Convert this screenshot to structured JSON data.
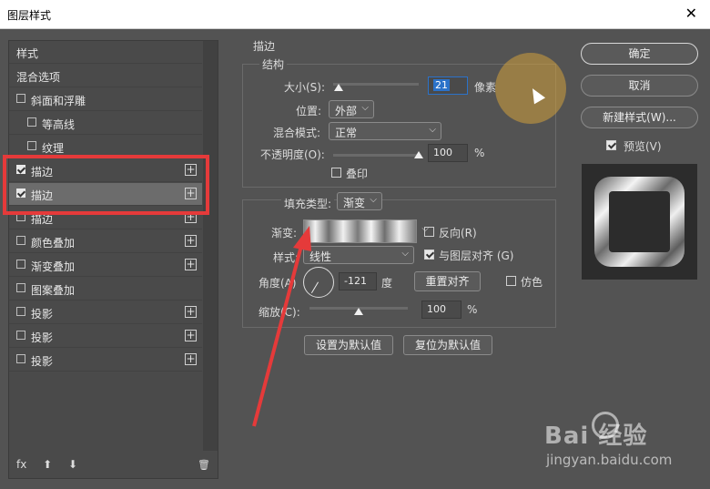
{
  "window": {
    "title": "图层样式",
    "close": "✕"
  },
  "left": {
    "items": [
      {
        "label": "样式",
        "checkbox": false,
        "plus": false,
        "indent": 0,
        "checked": false
      },
      {
        "label": "混合选项",
        "checkbox": false,
        "plus": false,
        "indent": 0,
        "checked": false
      },
      {
        "label": "斜面和浮雕",
        "checkbox": true,
        "plus": false,
        "indent": 0,
        "checked": false
      },
      {
        "label": "等高线",
        "checkbox": true,
        "plus": false,
        "indent": 1,
        "checked": false
      },
      {
        "label": "纹理",
        "checkbox": true,
        "plus": false,
        "indent": 1,
        "checked": false
      },
      {
        "label": "描边",
        "checkbox": true,
        "plus": true,
        "indent": 0,
        "checked": true
      },
      {
        "label": "描边",
        "checkbox": true,
        "plus": true,
        "indent": 0,
        "checked": true,
        "selected": true
      },
      {
        "label": "描边",
        "checkbox": true,
        "plus": true,
        "indent": 0,
        "checked": false
      },
      {
        "label": "颜色叠加",
        "checkbox": true,
        "plus": true,
        "indent": 0,
        "checked": false
      },
      {
        "label": "渐变叠加",
        "checkbox": true,
        "plus": true,
        "indent": 0,
        "checked": false
      },
      {
        "label": "图案叠加",
        "checkbox": true,
        "plus": false,
        "indent": 0,
        "checked": false
      },
      {
        "label": "投影",
        "checkbox": true,
        "plus": true,
        "indent": 0,
        "checked": false
      },
      {
        "label": "投影",
        "checkbox": true,
        "plus": true,
        "indent": 0,
        "checked": false
      },
      {
        "label": "投影",
        "checkbox": true,
        "plus": true,
        "indent": 0,
        "checked": false
      }
    ],
    "bottom": {
      "fx": "fx",
      "up": "⬆",
      "down": "⬇",
      "trash": "🗑"
    }
  },
  "stroke": {
    "group_title": "描边",
    "structure_title": "结构",
    "size_label": "大小(S):",
    "size_value": "21",
    "size_unit": "像素",
    "size_level": 0.06,
    "position_label": "位置:",
    "position_value": "外部",
    "blend_label": "混合模式:",
    "blend_value": "正常",
    "opacity_label": "不透明度(O):",
    "opacity_value": "100",
    "opacity_unit": "%",
    "opacity_level": 1.0,
    "overprint_label": "叠印",
    "fill_type_label": "填充类型:",
    "fill_type_value": "渐变",
    "gradient_label": "渐变:",
    "reverse_label": "反向(R)",
    "style_label": "样式:",
    "style_value": "线性",
    "align_label": "与图层对齐 (G)",
    "angle_label": "角度(A)",
    "angle_value": "-121",
    "angle_unit": "度",
    "reset_align_label": "重置对齐",
    "dither_label": "仿色",
    "scale_label": "缩放(C):",
    "scale_value": "100",
    "scale_unit": "%",
    "scale_level": 0.5,
    "set_default": "设置为默认值",
    "reset_default": "复位为默认值"
  },
  "right": {
    "ok": "确定",
    "cancel": "取消",
    "new_style": "新建样式(W)...",
    "preview_label": "预览(V)"
  },
  "watermark": {
    "brand": "Bai  经验",
    "url": "jingyan.baidu.com"
  },
  "colors": {
    "highlight": "#e53a3a",
    "arrow": "#e53a3a"
  }
}
